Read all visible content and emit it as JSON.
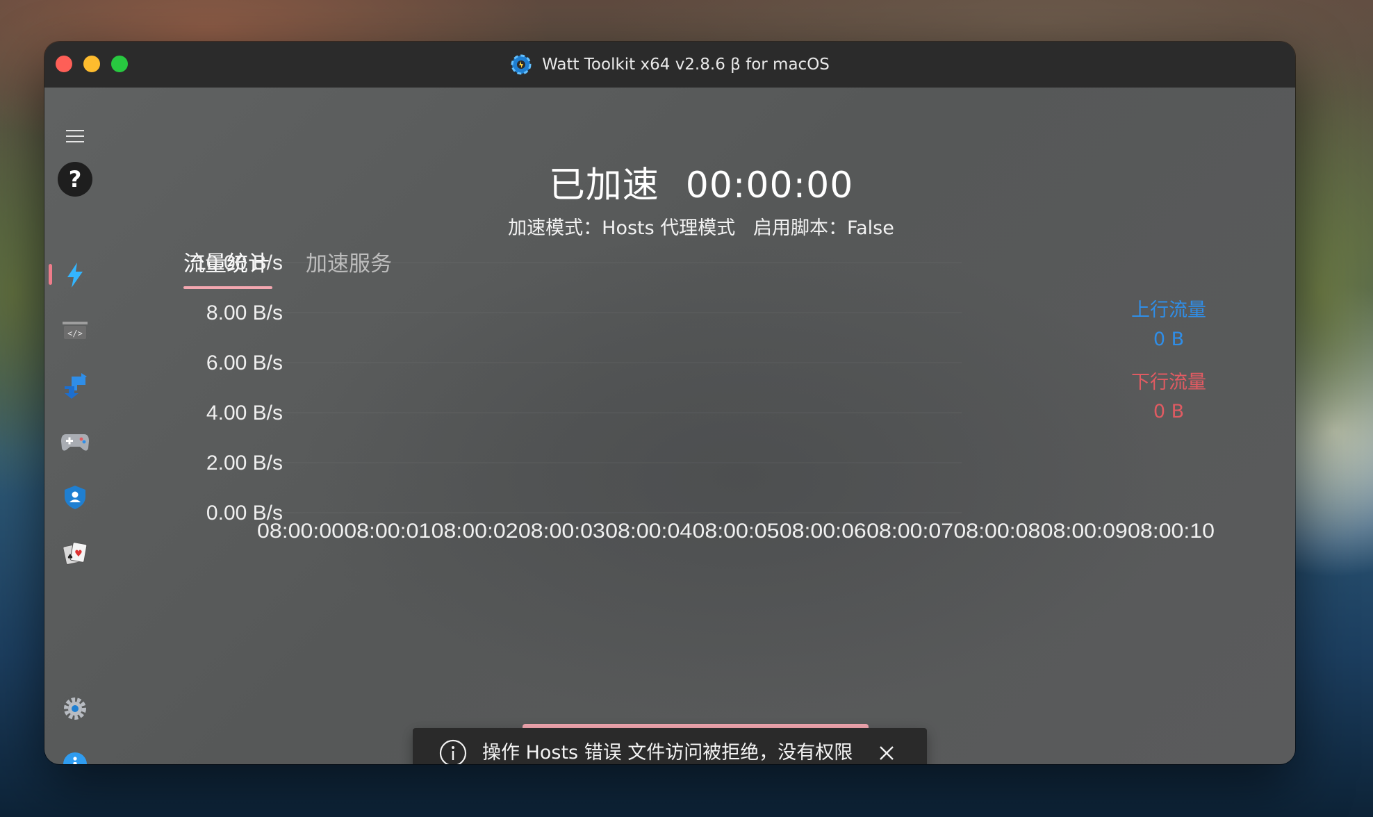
{
  "window": {
    "title": "Watt Toolkit x64 v2.8.6 β for macOS"
  },
  "sidebar": {
    "items": [
      {
        "name": "menu",
        "icon": "hamburger-icon"
      },
      {
        "name": "help",
        "icon": "question-icon"
      },
      {
        "name": "accelerator",
        "icon": "lightning-icon",
        "active": true
      },
      {
        "name": "script",
        "icon": "script-icon"
      },
      {
        "name": "account-switch",
        "icon": "account-switch-icon"
      },
      {
        "name": "game-list",
        "icon": "gamepad-icon"
      },
      {
        "name": "local-auth",
        "icon": "shield-user-icon"
      },
      {
        "name": "idle-card",
        "icon": "cards-icon"
      },
      {
        "name": "settings",
        "icon": "gear-icon"
      },
      {
        "name": "about",
        "icon": "info-icon"
      }
    ]
  },
  "header": {
    "status": "已加速",
    "timer": "00:00:00",
    "subtitle": "加速模式：Hosts 代理模式   启用脚本：False"
  },
  "tabs": [
    {
      "label": "流量统计",
      "active": true
    },
    {
      "label": "加速服务",
      "active": false
    }
  ],
  "chart_data": {
    "type": "line",
    "y_ticks": [
      "10.00 B/s",
      "8.00 B/s",
      "6.00 B/s",
      "4.00 B/s",
      "2.00 B/s",
      "0.00 B/s"
    ],
    "ylim": [
      0,
      10
    ],
    "x": [
      "08:00:00",
      "08:00:01",
      "08:00:02",
      "08:00:03",
      "08:00:04",
      "08:00:05",
      "08:00:06",
      "08:00:07",
      "08:00:08",
      "08:00:09",
      "08:00:10"
    ],
    "series": [
      {
        "name": "上行流量",
        "values": [
          0,
          0,
          0,
          0,
          0,
          0,
          0,
          0,
          0,
          0,
          0
        ],
        "color": "#2f8ee8"
      },
      {
        "name": "下行流量",
        "values": [
          0,
          0,
          0,
          0,
          0,
          0,
          0,
          0,
          0,
          0,
          0
        ],
        "color": "#e05b62"
      }
    ],
    "grid": true
  },
  "legend": {
    "upload_label": "上行流量",
    "upload_value": "0 B",
    "download_label": "下行流量",
    "download_value": "0 B"
  },
  "toast": {
    "message": "操作 Hosts 错误 文件访问被拒绝，没有权限"
  }
}
